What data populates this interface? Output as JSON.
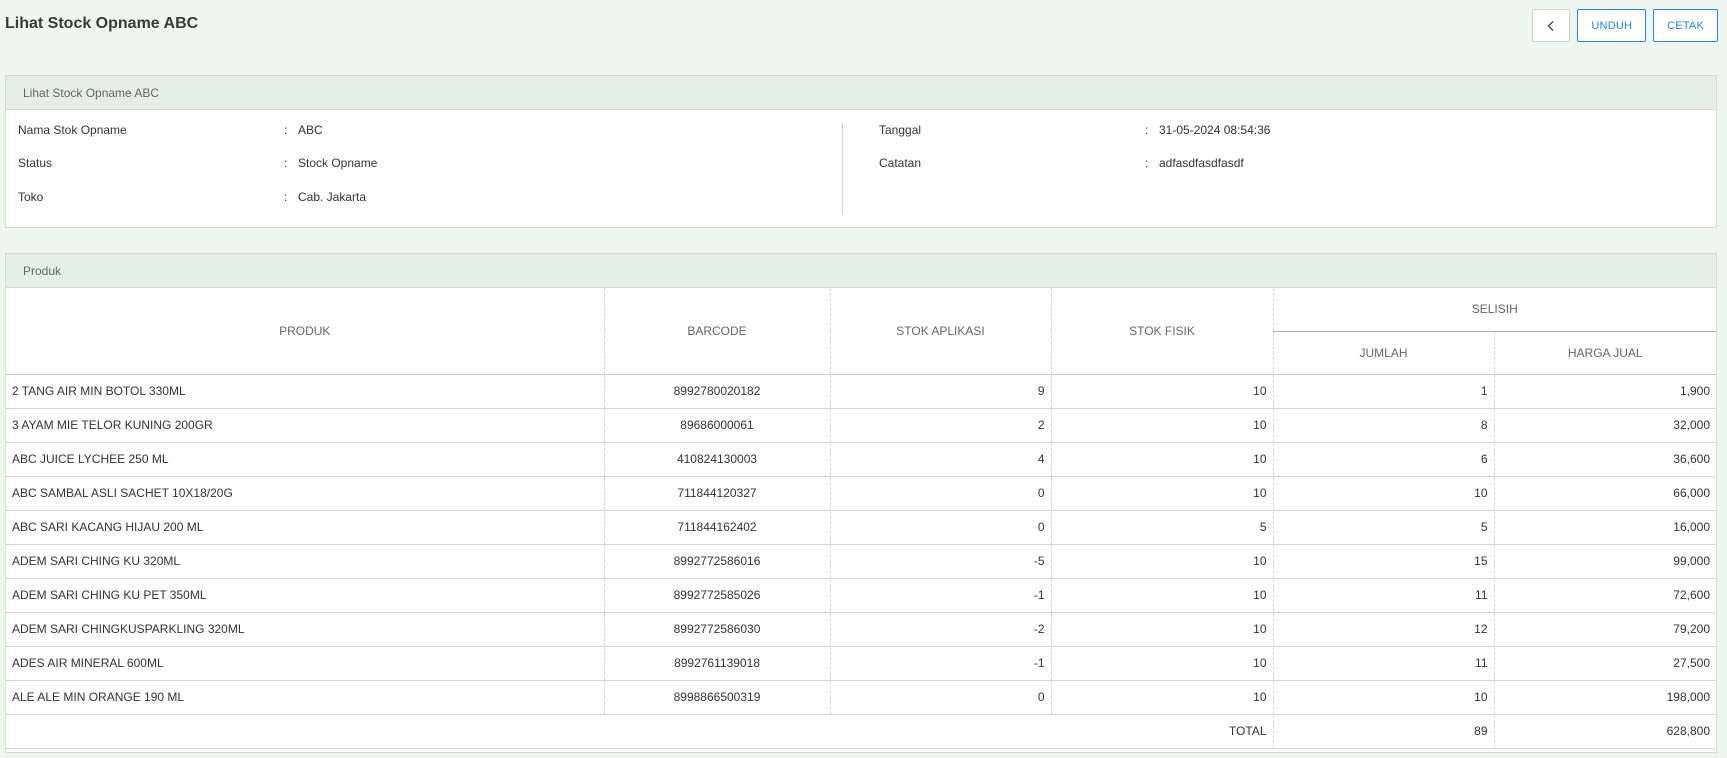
{
  "page": {
    "title": "Lihat Stock Opname ABC"
  },
  "toolbar": {
    "back_icon": "chevron-left-icon",
    "download_label": "UNDUH",
    "print_label": "CETAK",
    "accent": "#1e88e5"
  },
  "info": {
    "header": "Lihat Stock Opname ABC",
    "left": [
      {
        "label": "Nama Stok Opname",
        "value": "ABC"
      },
      {
        "label": "Status",
        "value": "Stock Opname"
      },
      {
        "label": "Toko",
        "value": "Cab. Jakarta"
      }
    ],
    "right": [
      {
        "label": "Tanggal",
        "value": "31-05-2024 08:54:36"
      },
      {
        "label": "Catatan",
        "value": "adfasdfasdfasdf"
      }
    ]
  },
  "products": {
    "header": "Produk",
    "columns": {
      "produk": "PRODUK",
      "barcode": "BARCODE",
      "stok_aplikasi": "STOK APLIKASI",
      "stok_fisik": "STOK FISIK",
      "selisih": "SELISIH",
      "jumlah": "JUMLAH",
      "harga_jual": "HARGA JUAL"
    },
    "rows": [
      {
        "produk": "2 TANG AIR MIN BOTOL 330ML",
        "barcode": "8992780020182",
        "stok_aplikasi": "9",
        "stok_fisik": "10",
        "jumlah": "1",
        "harga_jual": "1,900"
      },
      {
        "produk": "3 AYAM MIE TELOR KUNING 200GR",
        "barcode": "89686000061",
        "stok_aplikasi": "2",
        "stok_fisik": "10",
        "jumlah": "8",
        "harga_jual": "32,000"
      },
      {
        "produk": "ABC JUICE LYCHEE 250 ML",
        "barcode": "410824130003",
        "stok_aplikasi": "4",
        "stok_fisik": "10",
        "jumlah": "6",
        "harga_jual": "36,600"
      },
      {
        "produk": "ABC SAMBAL ASLI SACHET 10X18/20G",
        "barcode": "711844120327",
        "stok_aplikasi": "0",
        "stok_fisik": "10",
        "jumlah": "10",
        "harga_jual": "66,000"
      },
      {
        "produk": "ABC SARI KACANG HIJAU 200 ML",
        "barcode": "711844162402",
        "stok_aplikasi": "0",
        "stok_fisik": "5",
        "jumlah": "5",
        "harga_jual": "16,000"
      },
      {
        "produk": "ADEM SARI CHING KU 320ML",
        "barcode": "8992772586016",
        "stok_aplikasi": "-5",
        "stok_fisik": "10",
        "jumlah": "15",
        "harga_jual": "99,000"
      },
      {
        "produk": "ADEM SARI CHING KU PET 350ML",
        "barcode": "8992772585026",
        "stok_aplikasi": "-1",
        "stok_fisik": "10",
        "jumlah": "11",
        "harga_jual": "72,600"
      },
      {
        "produk": "ADEM SARI CHINGKUSPARKLING 320ML",
        "barcode": "8992772586030",
        "stok_aplikasi": "-2",
        "stok_fisik": "10",
        "jumlah": "12",
        "harga_jual": "79,200"
      },
      {
        "produk": "ADES AIR MINERAL 600ML",
        "barcode": "8992761139018",
        "stok_aplikasi": "-1",
        "stok_fisik": "10",
        "jumlah": "11",
        "harga_jual": "27,500"
      },
      {
        "produk": "ALE ALE MIN ORANGE 190 ML",
        "barcode": "8998866500319",
        "stok_aplikasi": "0",
        "stok_fisik": "10",
        "jumlah": "10",
        "harga_jual": "198,000"
      }
    ],
    "total": {
      "label": "TOTAL",
      "jumlah": "89",
      "harga_jual": "628,800"
    }
  }
}
